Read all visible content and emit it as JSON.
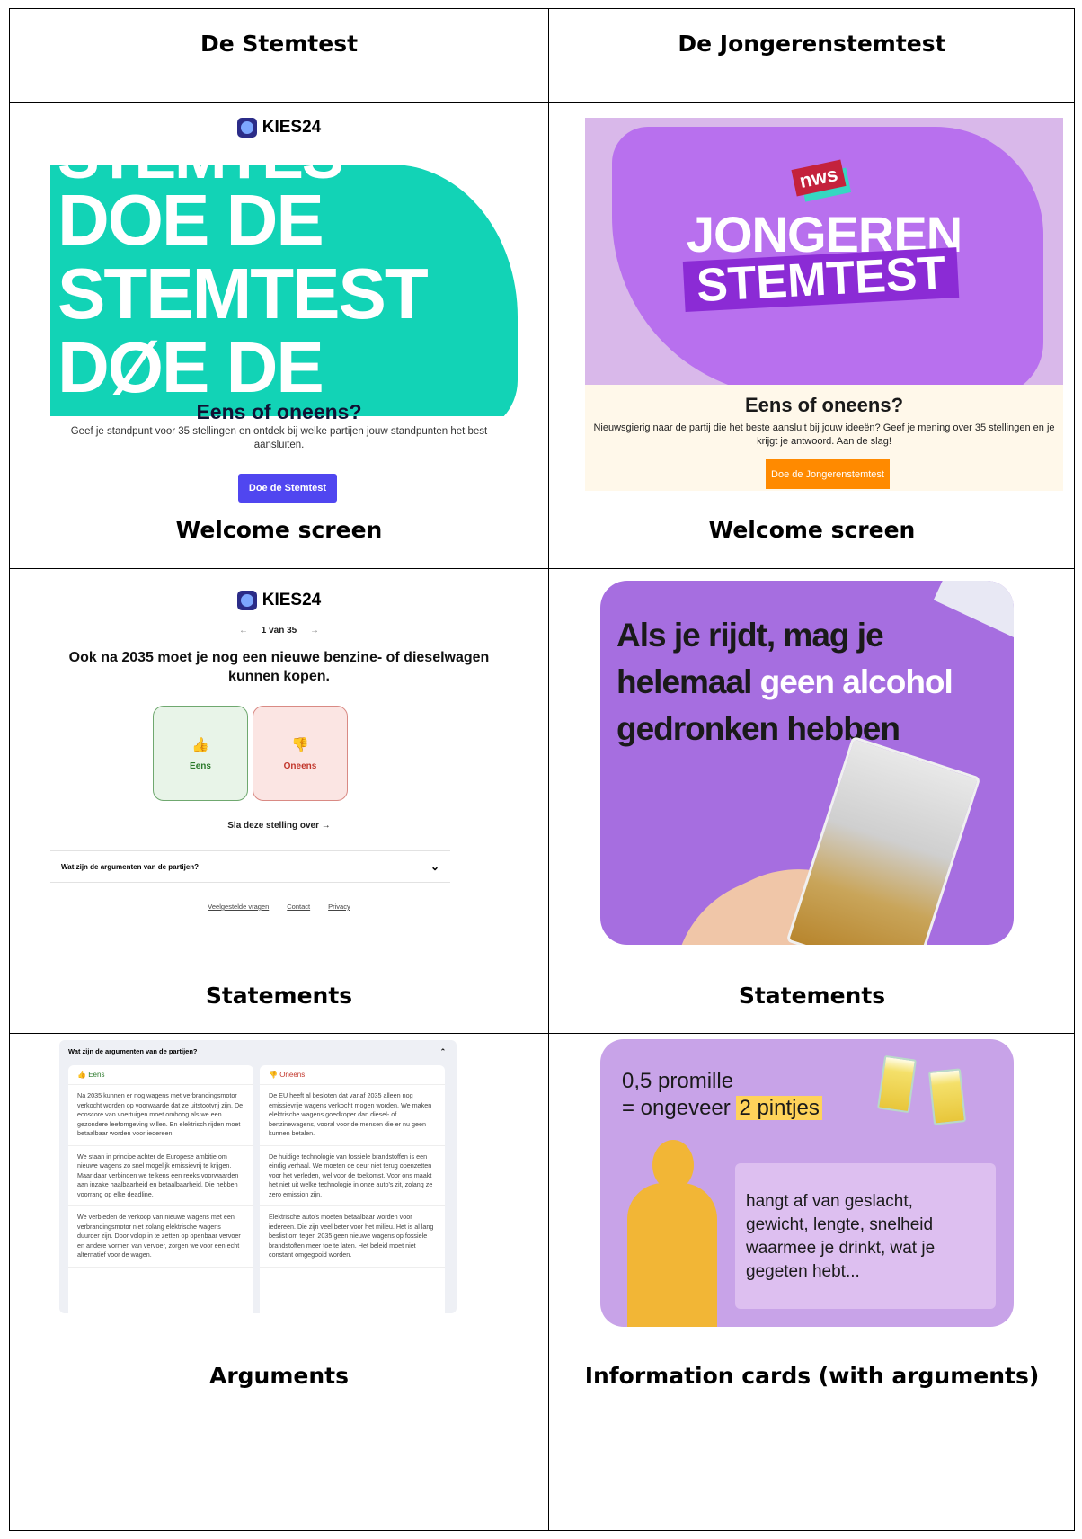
{
  "headers": {
    "left": "De Stemtest",
    "right": "De Jongerenstemtest"
  },
  "captions": {
    "row1_left": "Welcome screen",
    "row1_right": "Welcome screen",
    "row2_left": "Statements",
    "row2_right": "Statements",
    "row3_left": "Arguments",
    "row3_right": "Information cards (with arguments)"
  },
  "stemtest_welcome": {
    "logo": "KIES24",
    "art_lines": [
      "STEMTES",
      "DOE DE",
      "STEMTEST",
      "DØE DE"
    ],
    "title": "Eens of oneens?",
    "text": "Geef je standpunt voor 35 stellingen en ontdek bij welke partijen jouw standpunten het best aansluiten.",
    "button": "Doe de Stemtest"
  },
  "jongeren_welcome": {
    "badge": "nws",
    "title_line1": "JONGEREN",
    "title_line2": "STEMTEST",
    "title": "Eens of oneens?",
    "text": "Nieuwsgierig naar de partij die het beste aansluit bij jouw ideeën? Geef je mening over 35 stellingen en je krijgt je antwoord. Aan de slag!",
    "button": "Doe de Jongerenstemtest"
  },
  "stemtest_statement": {
    "logo": "KIES24",
    "prev": "←",
    "counter": "1 van 35",
    "next": "→",
    "question": "Ook na 2035 moet je nog een nieuwe benzine- of dieselwagen kunnen kopen.",
    "agree": "Eens",
    "disagree": "Oneens",
    "skip": "Sla deze stelling over →",
    "accordion": "Wat zijn de argumenten van de partijen?",
    "footer": [
      "Veelgestelde vragen",
      "Contact",
      "Privacy"
    ]
  },
  "jongeren_statement": {
    "line1": "Als je rijdt, mag je",
    "line2_a": "helemaal ",
    "line2_b": "geen alcohol",
    "line3": "gedronken hebben"
  },
  "arguments": {
    "heading": "Wat zijn de argumenten van de partijen?",
    "agree_title": "Eens",
    "disagree_title": "Oneens",
    "agree": [
      "Na 2035 kunnen er nog wagens met verbrandingsmotor verkocht worden op voorwaarde dat ze uitstootvrij zijn. De ecoscore van voertuigen moet omhoog als we een gezondere leefomgeving willen. En elektrisch rijden moet betaalbaar worden voor iedereen.",
      "We staan in principe achter de Europese ambitie om nieuwe wagens zo snel mogelijk emissievrij te krijgen. Maar daar verbinden we telkens een reeks voorwaarden aan inzake haalbaarheid en betaalbaarheid. Die hebben voorrang op elke deadline.",
      "We verbieden de verkoop van nieuwe wagens met een verbrandingsmotor niet zolang elektrische wagens duurder zijn. Door volop in te zetten op openbaar vervoer en andere vormen van vervoer, zorgen we voor een echt alternatief voor de wagen."
    ],
    "disagree": [
      "De EU heeft al besloten dat vanaf 2035 alleen nog emissievrije wagens verkocht mogen worden. We maken elektrische wagens goedkoper dan diesel- of benzinewagens, vooral voor de mensen die er nu geen kunnen betalen.",
      "De huidige technologie van fossiele brandstoffen is een eindig verhaal. We moeten de deur niet terug openzetten voor het verleden, wel voor de toekomst. Voor ons maakt het niet uit welke technologie in onze auto's zit, zolang ze zero emission zijn.",
      "Elektrische auto's moeten betaalbaar worden voor iedereen. Die zijn veel beter voor het milieu. Het is al lang beslist om tegen 2035 geen nieuwe wagens op fossiele brandstoffen meer toe te laten. Het beleid moet niet constant omgegooid worden."
    ]
  },
  "info_card": {
    "line1": "0,5 promille",
    "line2_a": "= ongeveer ",
    "line2_b": "2 pintjes",
    "speech": [
      "hangt af van geslacht,",
      "gewicht, lengte, snelheid",
      "waarmee je drinkt, wat je",
      "gegeten hebt..."
    ]
  },
  "colors": {
    "teal": "#12d3b6",
    "kies_purple": "#5046f0",
    "nws_orange": "#ff8a00",
    "nws_purple": "#b870ee"
  }
}
